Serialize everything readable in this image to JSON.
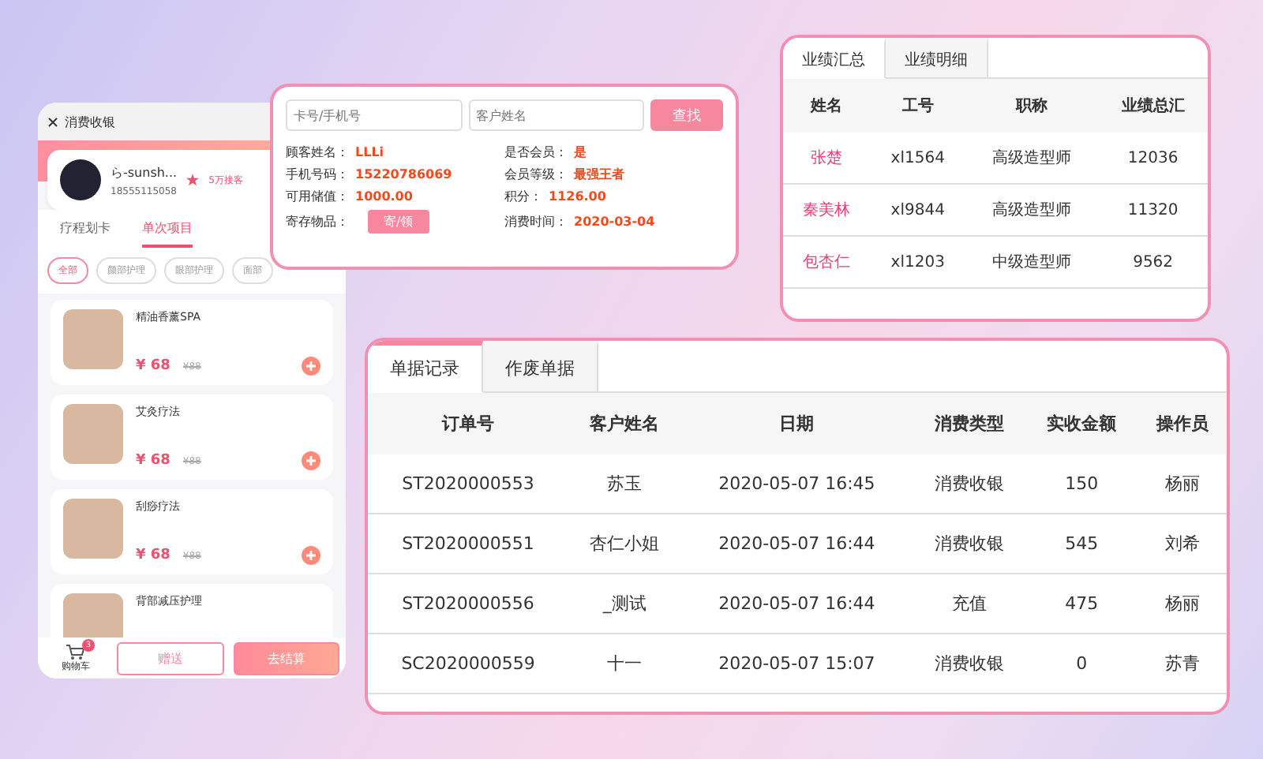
{
  "phone": {
    "title": "消费收银",
    "user": {
      "name": "ら-sunsh...",
      "phone": "18555115058",
      "badge": "5万接客"
    },
    "tabs": [
      {
        "label": "疗程划卡",
        "selected": false
      },
      {
        "label": "单次项目",
        "selected": true
      }
    ],
    "chips": [
      {
        "label": "全部",
        "selected": true
      },
      {
        "label": "颜部护理",
        "selected": false
      },
      {
        "label": "眼部护理",
        "selected": false
      },
      {
        "label": "面部",
        "selected": false
      }
    ],
    "products": [
      {
        "name": "精油香薰SPA",
        "price": "¥ 68",
        "old_price": "¥88"
      },
      {
        "name": "艾灸疗法",
        "price": "¥ 68",
        "old_price": "¥88"
      },
      {
        "name": "刮痧疗法",
        "price": "¥ 68",
        "old_price": "¥88"
      },
      {
        "name": "背部减压护理"
      }
    ],
    "cart": {
      "label": "购物车",
      "count": "3"
    },
    "gift_button": "赠送",
    "checkout_button": "去结算"
  },
  "lookup": {
    "card_placeholder": "卡号/手机号",
    "name_placeholder": "客户姓名",
    "search_button": "查找",
    "fields": [
      {
        "label": "顾客姓名：",
        "value": "LLLi"
      },
      {
        "label": "是否会员：",
        "value": "是"
      },
      {
        "label": "手机号码：",
        "value": "15220786069"
      },
      {
        "label": "会员等级：",
        "value": "最强王者"
      },
      {
        "label": "可用储值：",
        "value": "1000.00"
      },
      {
        "label": "积分：",
        "value": "1126.00"
      },
      {
        "label": "寄存物品：",
        "kind": "button",
        "value": "寄/领"
      },
      {
        "label": "消费时间：",
        "value": "2020-03-04"
      }
    ]
  },
  "performance": {
    "tabs": [
      {
        "label": "业绩汇总",
        "selected": true
      },
      {
        "label": "业绩明细",
        "selected": false
      }
    ],
    "columns": [
      "姓名",
      "工号",
      "职称",
      "业绩总汇"
    ],
    "rows": [
      [
        "张楚",
        "xl1564",
        "高级造型师",
        "12036"
      ],
      [
        "秦美林",
        "xl9844",
        "高级造型师",
        "11320"
      ],
      [
        "包杏仁",
        "xl1203",
        "中级造型师",
        "9562"
      ]
    ]
  },
  "orders": {
    "tabs": [
      {
        "label": "单据记录",
        "selected": true
      },
      {
        "label": "作废单据",
        "selected": false
      }
    ],
    "columns": [
      "订单号",
      "客户姓名",
      "日期",
      "消费类型",
      "实收金额",
      "操作员"
    ],
    "rows": [
      [
        "ST2020000553",
        "苏玉",
        "2020-05-07 16:45",
        "消费收银",
        "150",
        "杨丽"
      ],
      [
        "ST2020000551",
        "杏仁小姐",
        "2020-05-07 16:44",
        "消费收银",
        "545",
        "刘希"
      ],
      [
        "ST2020000556",
        "_测试",
        "2020-05-07 16:44",
        "充值",
        "475",
        "杨丽"
      ],
      [
        "SC2020000559",
        "十一",
        "2020-05-07 15:07",
        "消费收银",
        "0",
        "苏青"
      ]
    ]
  }
}
